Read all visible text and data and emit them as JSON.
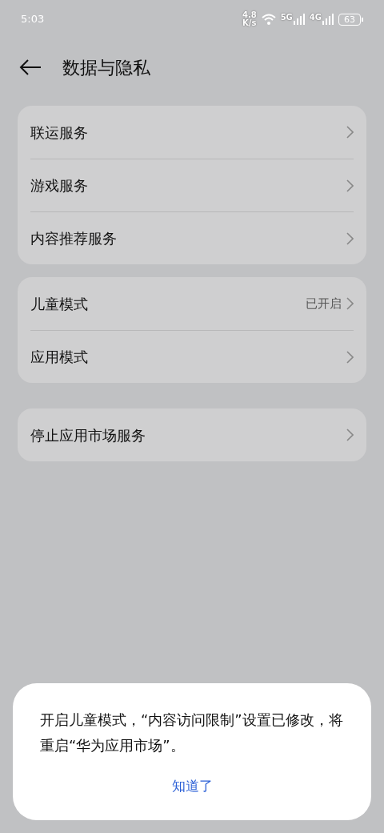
{
  "status_bar": {
    "time": "5:03",
    "speed_value": "4.8",
    "speed_unit": "K/s",
    "networks": [
      "5G",
      "4G"
    ],
    "battery": "63"
  },
  "header": {
    "title": "数据与隐私"
  },
  "groups": [
    {
      "items": [
        {
          "label": "联运服务"
        },
        {
          "label": "游戏服务"
        },
        {
          "label": "内容推荐服务"
        }
      ]
    },
    {
      "items": [
        {
          "label": "儿童模式",
          "value": "已开启"
        },
        {
          "label": "应用模式"
        }
      ]
    },
    {
      "items": [
        {
          "label": "停止应用市场服务"
        }
      ]
    }
  ],
  "dialog": {
    "message": "开启儿童模式，“内容访问限制”设置已修改，将重启“华为应用市场”。",
    "button": "知道了"
  }
}
